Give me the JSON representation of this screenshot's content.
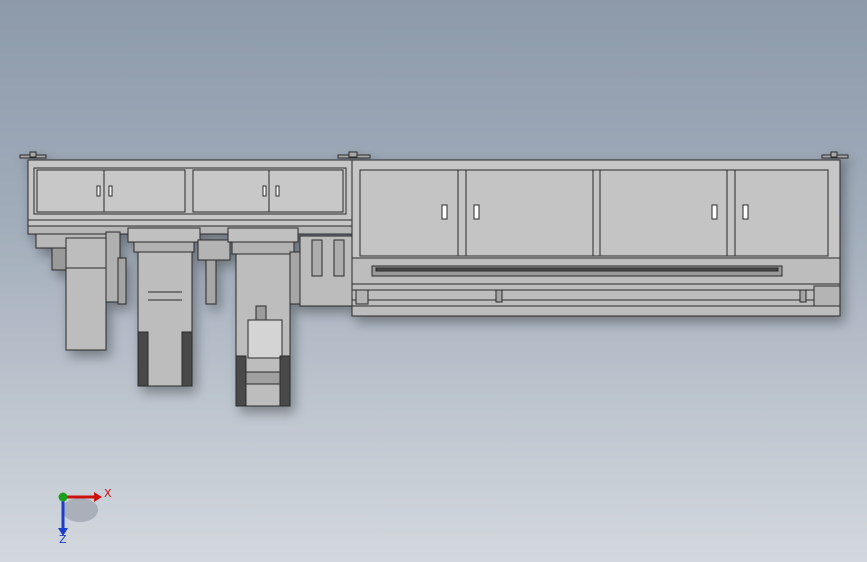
{
  "viewport": {
    "background_top": "#8d9aaa",
    "background_bottom": "#d3d8de"
  },
  "model": {
    "line_color": "#2a2a2a",
    "body_fill": "#bdbdbd",
    "panel_fill": "#c4c4c4",
    "dark_fill": "#4a4a4a"
  },
  "triad": {
    "x_label": "X",
    "z_label": "Z",
    "x_color": "#cc1111",
    "y_color": "#1aa01a",
    "z_color": "#1a3fd0"
  }
}
